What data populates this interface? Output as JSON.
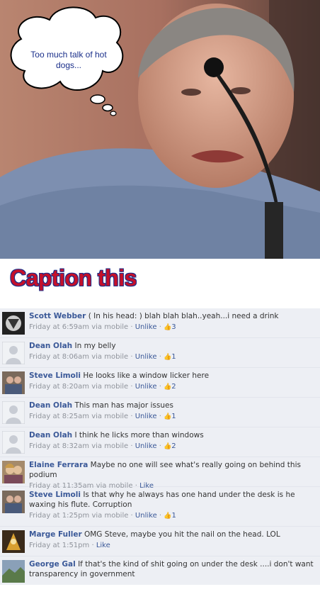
{
  "thought_bubble": {
    "text": "Too much talk of hot dogs..."
  },
  "caption": {
    "title": "Caption this"
  },
  "comments": [
    {
      "author": "Scott Webber",
      "text": "( In his head: ) blah blah blah..yeah...i need a drink",
      "time": "Friday at 6:59am",
      "via": "via mobile",
      "action": "Unlike",
      "likes": "3"
    },
    {
      "author": "Dean Olah",
      "text": "In my belly",
      "time": "Friday at 8:06am",
      "via": "via mobile",
      "action": "Unlike",
      "likes": "1"
    },
    {
      "author": "Steve Limoli",
      "text": "He looks like a window licker here",
      "time": "Friday at 8:20am",
      "via": "via mobile",
      "action": "Unlike",
      "likes": "2"
    },
    {
      "author": "Dean Olah",
      "text": "This man has major issues",
      "time": "Friday at 8:25am",
      "via": "via mobile",
      "action": "Unlike",
      "likes": "1"
    },
    {
      "author": "Dean Olah",
      "text": "I think he licks more than windows",
      "time": "Friday at 8:32am",
      "via": "via mobile",
      "action": "Unlike",
      "likes": "2"
    },
    {
      "author": "Elaine Ferrara",
      "text": "Maybe no one will see what's really going on behind this podium",
      "time": "Friday at 11:35am",
      "via": "via mobile",
      "action": "Like",
      "likes": ""
    },
    {
      "author": "Steve Limoli",
      "text": "Is that why he always has one hand under the desk is he waxing his flute. Corruption",
      "time": "Friday at 1:25pm",
      "via": "via mobile",
      "action": "Unlike",
      "likes": "1"
    },
    {
      "author": "Marge Fuller",
      "text": "OMG Steve, maybe you hit the nail on the head. LOL",
      "time": "Friday at 1:51pm",
      "via": "",
      "action": "Like",
      "likes": ""
    },
    {
      "author": "George Gal",
      "text": "If that's the kind of shit going on under the desk ....i don't want transparency in government",
      "time": "",
      "via": "",
      "action": "",
      "likes": ""
    }
  ],
  "colors": {
    "link": "#3b5998",
    "caption_red": "#c5102a",
    "caption_outline": "#1a2f8a",
    "feed_bg": "#edeff4"
  }
}
